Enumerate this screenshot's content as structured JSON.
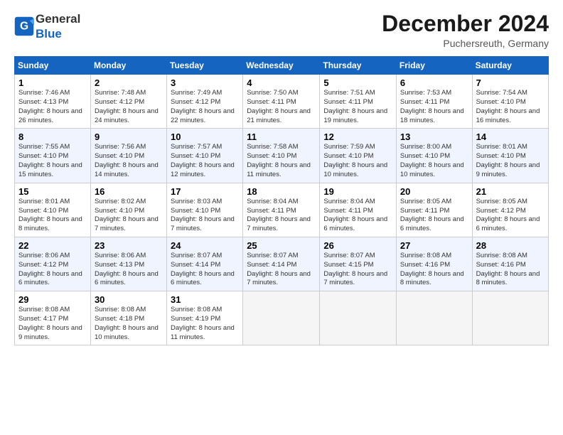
{
  "header": {
    "logo_general": "General",
    "logo_blue": "Blue",
    "month_title": "December 2024",
    "location": "Puchersreuth, Germany"
  },
  "weekdays": [
    "Sunday",
    "Monday",
    "Tuesday",
    "Wednesday",
    "Thursday",
    "Friday",
    "Saturday"
  ],
  "weeks": [
    [
      {
        "day": "1",
        "sunrise": "7:46 AM",
        "sunset": "4:13 PM",
        "daylight": "8 hours and 26 minutes."
      },
      {
        "day": "2",
        "sunrise": "7:48 AM",
        "sunset": "4:12 PM",
        "daylight": "8 hours and 24 minutes."
      },
      {
        "day": "3",
        "sunrise": "7:49 AM",
        "sunset": "4:12 PM",
        "daylight": "8 hours and 22 minutes."
      },
      {
        "day": "4",
        "sunrise": "7:50 AM",
        "sunset": "4:11 PM",
        "daylight": "8 hours and 21 minutes."
      },
      {
        "day": "5",
        "sunrise": "7:51 AM",
        "sunset": "4:11 PM",
        "daylight": "8 hours and 19 minutes."
      },
      {
        "day": "6",
        "sunrise": "7:53 AM",
        "sunset": "4:11 PM",
        "daylight": "8 hours and 18 minutes."
      },
      {
        "day": "7",
        "sunrise": "7:54 AM",
        "sunset": "4:10 PM",
        "daylight": "8 hours and 16 minutes."
      }
    ],
    [
      {
        "day": "8",
        "sunrise": "7:55 AM",
        "sunset": "4:10 PM",
        "daylight": "8 hours and 15 minutes."
      },
      {
        "day": "9",
        "sunrise": "7:56 AM",
        "sunset": "4:10 PM",
        "daylight": "8 hours and 14 minutes."
      },
      {
        "day": "10",
        "sunrise": "7:57 AM",
        "sunset": "4:10 PM",
        "daylight": "8 hours and 12 minutes."
      },
      {
        "day": "11",
        "sunrise": "7:58 AM",
        "sunset": "4:10 PM",
        "daylight": "8 hours and 11 minutes."
      },
      {
        "day": "12",
        "sunrise": "7:59 AM",
        "sunset": "4:10 PM",
        "daylight": "8 hours and 10 minutes."
      },
      {
        "day": "13",
        "sunrise": "8:00 AM",
        "sunset": "4:10 PM",
        "daylight": "8 hours and 10 minutes."
      },
      {
        "day": "14",
        "sunrise": "8:01 AM",
        "sunset": "4:10 PM",
        "daylight": "8 hours and 9 minutes."
      }
    ],
    [
      {
        "day": "15",
        "sunrise": "8:01 AM",
        "sunset": "4:10 PM",
        "daylight": "8 hours and 8 minutes."
      },
      {
        "day": "16",
        "sunrise": "8:02 AM",
        "sunset": "4:10 PM",
        "daylight": "8 hours and 7 minutes."
      },
      {
        "day": "17",
        "sunrise": "8:03 AM",
        "sunset": "4:10 PM",
        "daylight": "8 hours and 7 minutes."
      },
      {
        "day": "18",
        "sunrise": "8:04 AM",
        "sunset": "4:11 PM",
        "daylight": "8 hours and 7 minutes."
      },
      {
        "day": "19",
        "sunrise": "8:04 AM",
        "sunset": "4:11 PM",
        "daylight": "8 hours and 6 minutes."
      },
      {
        "day": "20",
        "sunrise": "8:05 AM",
        "sunset": "4:11 PM",
        "daylight": "8 hours and 6 minutes."
      },
      {
        "day": "21",
        "sunrise": "8:05 AM",
        "sunset": "4:12 PM",
        "daylight": "8 hours and 6 minutes."
      }
    ],
    [
      {
        "day": "22",
        "sunrise": "8:06 AM",
        "sunset": "4:12 PM",
        "daylight": "8 hours and 6 minutes."
      },
      {
        "day": "23",
        "sunrise": "8:06 AM",
        "sunset": "4:13 PM",
        "daylight": "8 hours and 6 minutes."
      },
      {
        "day": "24",
        "sunrise": "8:07 AM",
        "sunset": "4:14 PM",
        "daylight": "8 hours and 6 minutes."
      },
      {
        "day": "25",
        "sunrise": "8:07 AM",
        "sunset": "4:14 PM",
        "daylight": "8 hours and 7 minutes."
      },
      {
        "day": "26",
        "sunrise": "8:07 AM",
        "sunset": "4:15 PM",
        "daylight": "8 hours and 7 minutes."
      },
      {
        "day": "27",
        "sunrise": "8:08 AM",
        "sunset": "4:16 PM",
        "daylight": "8 hours and 8 minutes."
      },
      {
        "day": "28",
        "sunrise": "8:08 AM",
        "sunset": "4:16 PM",
        "daylight": "8 hours and 8 minutes."
      }
    ],
    [
      {
        "day": "29",
        "sunrise": "8:08 AM",
        "sunset": "4:17 PM",
        "daylight": "8 hours and 9 minutes."
      },
      {
        "day": "30",
        "sunrise": "8:08 AM",
        "sunset": "4:18 PM",
        "daylight": "8 hours and 10 minutes."
      },
      {
        "day": "31",
        "sunrise": "8:08 AM",
        "sunset": "4:19 PM",
        "daylight": "8 hours and 11 minutes."
      },
      null,
      null,
      null,
      null
    ]
  ]
}
